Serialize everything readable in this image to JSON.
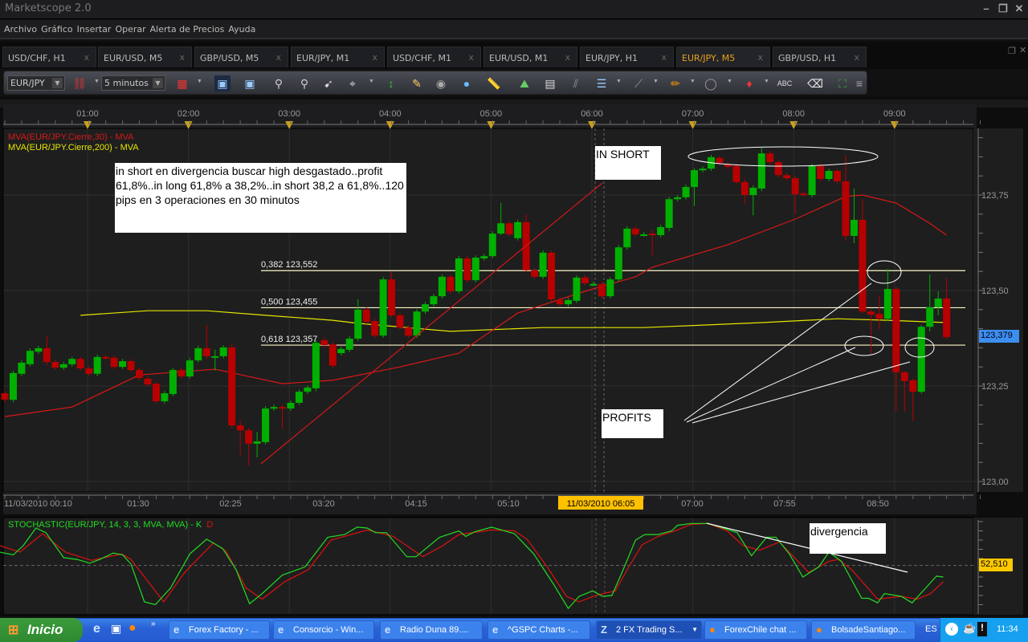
{
  "window": {
    "title": "Marketscope 2.0"
  },
  "menu": [
    "Archivo",
    "Gráfico",
    "Insertar",
    "Operar",
    "Alerta de Precios",
    "Ayuda"
  ],
  "tabs": [
    {
      "label": "USD/CHF, H1"
    },
    {
      "label": "EUR/USD, M5"
    },
    {
      "label": "GBP/USD, M5"
    },
    {
      "label": "EUR/JPY, M1"
    },
    {
      "label": "USD/CHF, M1"
    },
    {
      "label": "EUR/USD, M1"
    },
    {
      "label": "EUR/JPY, H1"
    },
    {
      "label": "EUR/JPY, M5",
      "active": true
    },
    {
      "label": "GBP/USD, H1"
    }
  ],
  "tab_close": "x",
  "toolbar": {
    "symbol": "EUR/JPY",
    "timeframe": "5 minutos"
  },
  "chart": {
    "top_time_labels": [
      "01:00",
      "02:00",
      "03:00",
      "04:00",
      "05:00",
      "06:00",
      "07:00",
      "08:00",
      "09:00"
    ],
    "bottom_time_labels": [
      "11/03/2010 00:10",
      "01:30",
      "02:25",
      "03:20",
      "04:15",
      "05:10",
      "11/03/2010 06:05",
      "07:00",
      "07:55",
      "08:50"
    ],
    "legend_ma30": "MVA(EUR/JPY.Cierre,30) - MVA",
    "legend_ma200": "MVA(EUR/JPY.Cierre,200) - MVA",
    "price_labels": [
      "123,75",
      "123,50",
      "123,25",
      "123,00"
    ],
    "current_price": "123,379",
    "fib": [
      {
        "label": "0,382 123,552",
        "price": 123.552
      },
      {
        "label": "0,500 123,455",
        "price": 123.455
      },
      {
        "label": "0,618 123,357",
        "price": 123.357
      }
    ],
    "notes": {
      "main": "in short en divergencia buscar high desgastado..profit 61,8%..in long 61,8% a 38,2%..in short 38,2 a 61,8%..120 pips en 3 operaciones en 30 minutos",
      "in_short": "IN SHORT",
      "profits": "PROFITS",
      "divergencia": "divergencia"
    },
    "colors": {
      "up": "#00b000",
      "down": "#b80000",
      "ma30": "#d81818",
      "ma200": "#e6e600",
      "fib": "#fff8c8",
      "k": "#22dd22",
      "d": "#dd1111"
    }
  },
  "chart_data": {
    "type": "candlestick",
    "symbol": "EUR/JPY",
    "interval": "5 min",
    "first_bar_time": "11/03/2010 00:10",
    "ylim": [
      123.0,
      123.9
    ],
    "candles_ochl_note": "[open, close, high?, low?] per 5-minute bar",
    "candles": [
      [
        123.231,
        123.214
      ],
      [
        123.214,
        123.284
      ],
      [
        123.282,
        123.311
      ],
      [
        123.307,
        123.342
      ],
      [
        123.34,
        123.349
      ],
      [
        123.349,
        123.313,
        123.38,
        123.305
      ],
      [
        123.313,
        123.298
      ],
      [
        123.298,
        123.307
      ],
      [
        123.307,
        123.321
      ],
      [
        123.321,
        123.296
      ],
      [
        123.296,
        123.282
      ],
      [
        123.282,
        123.326
      ],
      [
        123.326,
        123.325
      ],
      [
        123.324,
        123.3
      ],
      [
        123.3,
        123.315
      ],
      [
        123.315,
        123.292
      ],
      [
        123.292,
        123.271
      ],
      [
        123.269,
        123.254
      ],
      [
        123.256,
        123.21
      ],
      [
        123.21,
        123.231
      ],
      [
        123.229,
        123.292
      ],
      [
        123.292,
        123.275
      ],
      [
        123.275,
        123.317
      ],
      [
        123.317,
        123.349
      ],
      [
        123.349,
        123.328,
        123.41,
        123.32
      ],
      [
        123.328,
        123.328,
        123.345,
        123.29
      ],
      [
        123.328,
        123.351
      ],
      [
        123.351,
        123.147,
        123.36,
        123.14
      ],
      [
        123.147,
        123.134,
        123.16,
        123.069
      ],
      [
        123.134,
        123.099,
        123.14,
        123.042
      ],
      [
        123.099,
        123.105,
        123.13,
        123.063
      ],
      [
        123.103,
        123.191
      ],
      [
        123.191,
        123.195
      ],
      [
        123.195,
        123.191,
        123.2,
        123.137
      ],
      [
        123.191,
        123.206
      ],
      [
        123.206,
        123.235
      ],
      [
        123.235,
        123.246
      ],
      [
        123.244,
        123.363,
        123.37,
        123.236
      ],
      [
        123.37,
        123.357
      ],
      [
        123.359,
        123.303
      ],
      [
        123.336,
        123.347
      ],
      [
        123.345,
        123.374
      ],
      [
        123.374,
        123.45,
        123.477,
        123.368
      ],
      [
        123.45,
        123.418
      ],
      [
        123.42,
        123.382
      ],
      [
        123.382,
        123.529
      ],
      [
        123.529,
        123.435,
        123.551,
        123.43
      ],
      [
        123.435,
        123.403
      ],
      [
        123.403,
        123.382
      ],
      [
        123.382,
        123.445
      ],
      [
        123.445,
        123.464
      ],
      [
        123.464,
        123.485
      ],
      [
        123.485,
        123.536
      ],
      [
        123.536,
        123.498
      ],
      [
        123.498,
        123.584
      ],
      [
        123.584,
        123.527
      ],
      [
        123.527,
        123.586
      ],
      [
        123.584,
        123.59
      ],
      [
        123.59,
        123.649
      ],
      [
        123.649,
        123.676,
        123.729,
        123.645
      ],
      [
        123.676,
        123.647
      ],
      [
        123.637,
        123.679
      ],
      [
        123.679,
        123.553,
        123.7,
        123.548
      ],
      [
        123.553,
        123.536
      ],
      [
        123.536,
        123.599
      ],
      [
        123.599,
        123.477
      ],
      [
        123.475,
        123.464
      ],
      [
        123.464,
        123.475
      ],
      [
        123.473,
        123.534
      ],
      [
        123.534,
        123.519
      ],
      [
        123.517,
        123.517
      ],
      [
        123.517,
        123.485
      ],
      [
        123.485,
        123.529
      ],
      [
        123.529,
        123.613
      ],
      [
        123.613,
        123.662
      ],
      [
        123.662,
        123.647
      ],
      [
        123.647,
        123.647
      ],
      [
        123.649,
        123.645,
        123.66,
        123.592
      ],
      [
        123.645,
        123.666
      ],
      [
        123.664,
        123.739,
        123.745,
        123.655
      ],
      [
        123.739,
        123.744
      ],
      [
        123.744,
        123.771
      ],
      [
        123.771,
        123.815,
        123.82,
        123.721
      ],
      [
        123.815,
        123.819
      ],
      [
        123.819,
        123.849
      ],
      [
        123.847,
        123.834
      ],
      [
        123.83,
        123.824
      ],
      [
        123.826,
        123.784
      ],
      [
        123.784,
        123.75,
        123.79,
        123.727
      ],
      [
        123.75,
        123.769,
        123.775,
        123.697
      ],
      [
        123.767,
        123.859,
        123.874,
        123.76
      ],
      [
        123.859,
        123.836
      ],
      [
        123.836,
        123.802
      ],
      [
        123.802,
        123.794
      ],
      [
        123.794,
        123.752,
        123.8,
        123.7
      ],
      [
        123.754,
        123.752
      ],
      [
        123.75,
        123.826
      ],
      [
        123.826,
        123.792
      ],
      [
        123.792,
        123.813
      ],
      [
        123.813,
        123.786
      ],
      [
        123.786,
        123.643,
        123.855,
        123.63
      ],
      [
        123.643,
        123.685,
        123.767,
        123.624
      ],
      [
        123.685,
        123.445,
        123.739,
        123.44
      ],
      [
        123.445,
        123.437,
        123.45,
        123.332
      ],
      [
        123.439,
        123.426,
        123.487,
        123.399
      ],
      [
        123.426,
        123.504,
        123.557,
        123.42
      ],
      [
        123.504,
        123.286,
        123.51,
        123.185
      ],
      [
        123.286,
        123.263,
        123.29,
        123.183
      ],
      [
        123.265,
        123.235,
        123.27,
        123.158
      ],
      [
        123.235,
        123.405,
        123.41,
        123.23
      ],
      [
        123.405,
        123.456,
        123.542,
        123.393
      ],
      [
        123.456,
        123.479,
        123.498,
        123.435
      ],
      [
        123.479,
        123.378,
        123.532,
        123.372
      ]
    ],
    "ma30": [
      [
        1,
        123.17
      ],
      [
        9,
        123.195
      ],
      [
        17,
        123.279
      ],
      [
        26,
        123.294
      ],
      [
        34,
        123.256
      ],
      [
        40,
        123.265
      ],
      [
        48,
        123.3
      ],
      [
        55,
        123.336
      ],
      [
        62,
        123.441
      ],
      [
        70,
        123.498
      ],
      [
        76,
        123.536
      ],
      [
        78,
        123.561
      ],
      [
        87,
        123.62
      ],
      [
        95,
        123.687
      ],
      [
        101,
        123.746
      ],
      [
        103,
        123.75
      ],
      [
        107,
        123.729
      ],
      [
        111,
        123.676
      ],
      [
        113,
        123.645
      ]
    ],
    "ma200": [
      [
        10,
        123.435
      ],
      [
        18,
        123.447
      ],
      [
        25,
        123.447
      ],
      [
        32,
        123.435
      ],
      [
        40,
        123.422
      ],
      [
        43,
        123.414
      ],
      [
        54,
        123.393
      ],
      [
        65,
        123.403
      ],
      [
        77,
        123.403
      ],
      [
        91,
        123.416
      ],
      [
        100,
        123.426
      ],
      [
        106,
        123.422
      ],
      [
        113,
        123.416
      ]
    ],
    "stochastic": {
      "label_k": "STOCHASTIC(EUR/JPY, 14, 3, 3, MVA, MVA) - K",
      "label_d": "D",
      "level": "52,510",
      "k": [
        [
          0.4,
          67
        ],
        [
          2.0,
          64
        ],
        [
          3.2,
          74
        ],
        [
          4.7,
          93
        ],
        [
          5.9,
          88
        ],
        [
          8.0,
          61
        ],
        [
          9.6,
          59
        ],
        [
          11.1,
          55
        ],
        [
          12.3,
          59
        ],
        [
          13.9,
          66
        ],
        [
          15.0,
          64
        ],
        [
          16.0,
          54
        ],
        [
          17.6,
          13
        ],
        [
          18.9,
          10
        ],
        [
          20.7,
          28
        ],
        [
          23.0,
          65
        ],
        [
          25.0,
          81
        ],
        [
          26.9,
          71
        ],
        [
          28.5,
          48
        ],
        [
          30.1,
          11
        ],
        [
          31.6,
          22
        ],
        [
          34.0,
          42
        ],
        [
          36.7,
          51
        ],
        [
          39.4,
          83
        ],
        [
          41.4,
          86
        ],
        [
          42.9,
          94
        ],
        [
          44.1,
          93
        ],
        [
          45.1,
          88
        ],
        [
          46.4,
          88
        ],
        [
          48.8,
          62
        ],
        [
          49.9,
          62
        ],
        [
          52.7,
          83
        ],
        [
          55.0,
          90
        ],
        [
          55.8,
          84
        ],
        [
          56.9,
          89
        ],
        [
          58.9,
          94
        ],
        [
          61.6,
          87
        ],
        [
          63.9,
          65
        ],
        [
          66.2,
          33
        ],
        [
          68.0,
          6
        ],
        [
          69.3,
          19
        ],
        [
          70.9,
          25
        ],
        [
          72.1,
          19
        ],
        [
          73.2,
          20
        ],
        [
          74.4,
          45
        ],
        [
          76.0,
          80
        ],
        [
          77.1,
          86
        ],
        [
          78.7,
          86
        ],
        [
          80.3,
          90
        ],
        [
          81.0,
          96
        ],
        [
          82.6,
          98
        ],
        [
          84.6,
          98
        ],
        [
          86.1,
          94
        ],
        [
          88.1,
          88
        ],
        [
          89.8,
          63
        ],
        [
          91.6,
          83
        ],
        [
          92.7,
          83
        ],
        [
          94.3,
          65
        ],
        [
          95.9,
          40
        ],
        [
          97.8,
          51
        ],
        [
          99.0,
          67
        ],
        [
          100.5,
          57
        ],
        [
          102.9,
          17
        ],
        [
          103.7,
          17
        ],
        [
          104.8,
          12
        ],
        [
          105.6,
          22
        ],
        [
          107.6,
          19
        ],
        [
          108.9,
          12
        ],
        [
          110.3,
          26
        ],
        [
          111.8,
          41
        ],
        [
          112.6,
          40
        ]
      ],
      "d": [
        [
          0.4,
          74
        ],
        [
          2.8,
          67
        ],
        [
          5.5,
          87
        ],
        [
          8.2,
          67
        ],
        [
          11.3,
          58
        ],
        [
          14.9,
          65
        ],
        [
          16.0,
          59
        ],
        [
          19.9,
          13
        ],
        [
          22.3,
          44
        ],
        [
          25.8,
          77
        ],
        [
          27.3,
          68
        ],
        [
          29.7,
          28
        ],
        [
          31.6,
          16
        ],
        [
          34.3,
          35
        ],
        [
          37.1,
          48
        ],
        [
          39.8,
          80
        ],
        [
          44.1,
          91
        ],
        [
          47.2,
          84
        ],
        [
          50.7,
          62
        ],
        [
          53.1,
          74
        ],
        [
          55.0,
          86
        ],
        [
          58.9,
          91
        ],
        [
          61.6,
          90
        ],
        [
          63.1,
          81
        ],
        [
          65.5,
          51
        ],
        [
          67.8,
          19
        ],
        [
          69.3,
          13
        ],
        [
          71.3,
          20
        ],
        [
          73.6,
          25
        ],
        [
          75.2,
          51
        ],
        [
          76.8,
          75
        ],
        [
          78.7,
          84
        ],
        [
          81.0,
          91
        ],
        [
          82.6,
          97
        ],
        [
          84.6,
          98
        ],
        [
          86.9,
          90
        ],
        [
          88.8,
          74
        ],
        [
          90.8,
          69
        ],
        [
          93.1,
          78
        ],
        [
          95.1,
          59
        ],
        [
          96.6,
          45
        ],
        [
          99.0,
          57
        ],
        [
          100.1,
          59
        ],
        [
          101.7,
          48
        ],
        [
          104.8,
          16
        ],
        [
          107.6,
          19
        ],
        [
          109.5,
          16
        ],
        [
          111.1,
          22
        ],
        [
          112.6,
          35
        ]
      ]
    }
  },
  "taskbar": {
    "start": "Inicio",
    "items": [
      {
        "label": "Forex Factory - ..."
      },
      {
        "label": "Consorcio - Win..."
      },
      {
        "label": "Radio Duna 89...."
      },
      {
        "label": "^GSPC Charts -..."
      },
      {
        "label": "2 FX Trading S...",
        "active": true
      },
      {
        "label": "ForexChile chat ..."
      },
      {
        "label": "BolsadeSantiago..."
      }
    ],
    "lang": "ES",
    "clock": "11:34"
  }
}
